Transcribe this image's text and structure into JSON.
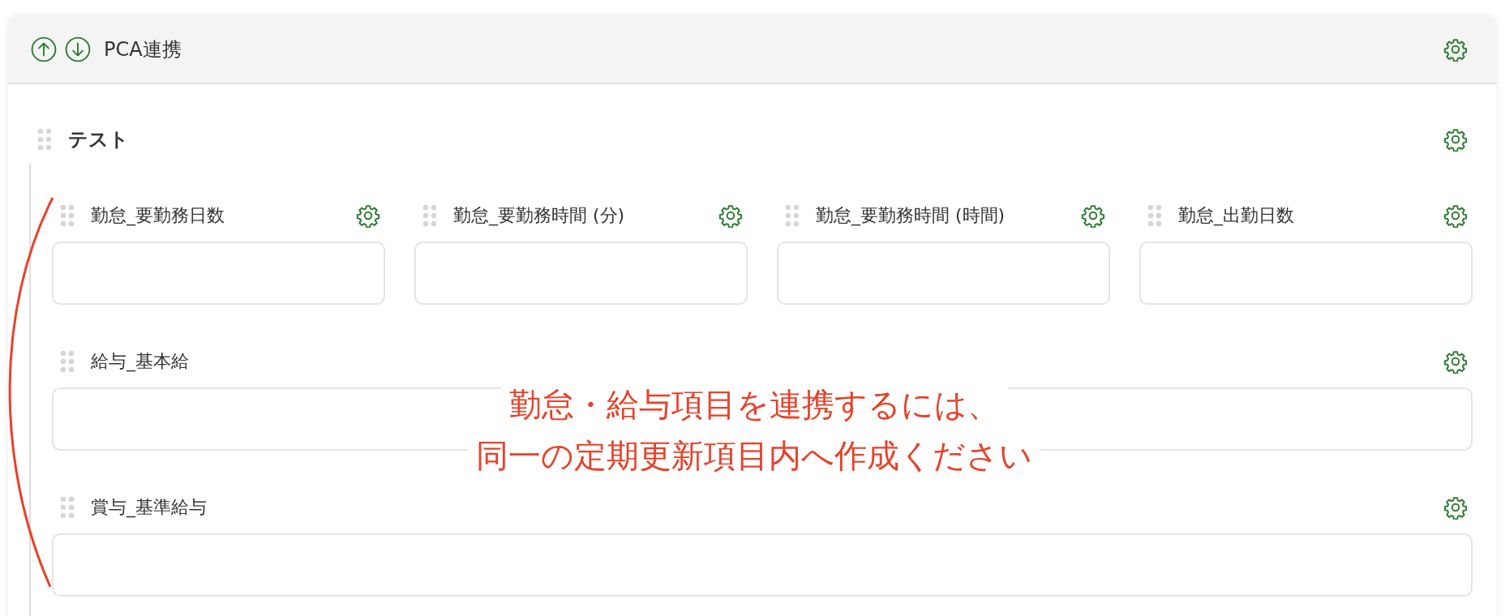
{
  "panel": {
    "title": "PCA連携"
  },
  "section": {
    "title": "テスト"
  },
  "rows": [
    [
      {
        "label": "勤怠_要勤務日数"
      },
      {
        "label": "勤怠_要勤務時間 (分)"
      },
      {
        "label": "勤怠_要勤務時間 (時間)"
      },
      {
        "label": "勤怠_出勤日数"
      }
    ],
    [
      {
        "label": "給与_基本給"
      }
    ],
    [
      {
        "label": "賞与_基準給与"
      }
    ]
  ],
  "annotation": {
    "lines": [
      "勤怠・給与項目を連携するには、",
      "同一の定期更新項目内へ作成ください"
    ]
  }
}
